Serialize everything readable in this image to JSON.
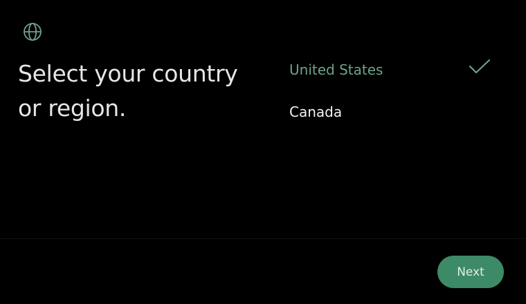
{
  "header": {
    "icon": "globe-icon",
    "title": "Select your country or region."
  },
  "countries": {
    "items": [
      {
        "label": "United States",
        "selected": true
      },
      {
        "label": "Canada",
        "selected": false
      }
    ],
    "selected_icon": "checkmark-icon"
  },
  "footer": {
    "next_label": "Next"
  },
  "colors": {
    "background": "#000000",
    "accent": "#6fa38a",
    "button": "#3d8a66",
    "text": "#f2f2f2"
  }
}
